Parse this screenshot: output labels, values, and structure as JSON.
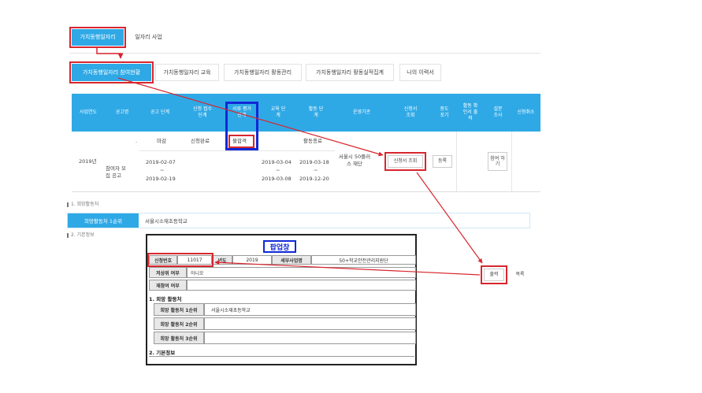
{
  "tabs_top": [
    "가치동행일자리",
    "일자리 사업"
  ],
  "tabs_sub": [
    "가치동행일자리 참여현황",
    "가치동행일자리 교육",
    "가치동행일자리 활동관리",
    "가치동행일자리 활동실적집계",
    "나의 이력서"
  ],
  "table": {
    "headers": [
      "사업연도",
      "공고명",
      "공고 단계",
      "신청 접수 단계",
      "서류 평가 단계",
      "교육 단계",
      "활동 단계",
      "운영기관",
      "신청서 조회",
      "중도 포기",
      "활동 확인서 출력",
      "설문 조사",
      "신청취소"
    ],
    "row": {
      "year": "2019년",
      "dot": "·",
      "notice_title": "참여자 모집 공고",
      "notice_stage": "마감",
      "notice_date_from": "2019-02-07",
      "tilde": "~",
      "notice_date_to": "2019-02-19",
      "apply_stage": "신청완료",
      "review_stage": "불합격",
      "edu_date_from": "2019-03-04",
      "edu_date_to": "2019-03-08",
      "activity_stage": "활동종료",
      "activity_date_from": "2019-03-18",
      "activity_date_to": "2019-12-20",
      "org": "서울시 50플러스 재단",
      "view_button": "신청서 조회",
      "register_button": "등록",
      "survey_button": "참여 하기"
    }
  },
  "section1": {
    "title": "1. 희망활동처",
    "label": "희망활동처 1순위",
    "value": "서울시소재초등학교"
  },
  "section2": {
    "title": "2. 기본정보"
  },
  "popup": {
    "title": "팝업창",
    "app_no_label": "신청번호",
    "app_no_value": "11017",
    "year_label": "년도",
    "year_value": "2019",
    "biz_label": "세부사업명",
    "biz_value": "50+학교안전관리지원단",
    "low_income_label": "저상위 여부",
    "low_income_value": "아니오",
    "reentry_label": "재참여 여부",
    "sec1_title": "1. 희망 활동처",
    "pref1_label": "희망 활동처 1순위",
    "pref1_value": "서울시소재초등학교",
    "pref2_label": "희망 활동처 2순위",
    "pref3_label": "희망 활동처 3순위",
    "sec2_title": "2. 기본정보"
  },
  "bottom_buttons": {
    "print": "출력",
    "list": "목록"
  },
  "colors": {
    "accent": "#2fa9e6",
    "highlight": "#d8262e",
    "blue_box": "#1228d6",
    "section_bar": "#2fa9e6"
  }
}
